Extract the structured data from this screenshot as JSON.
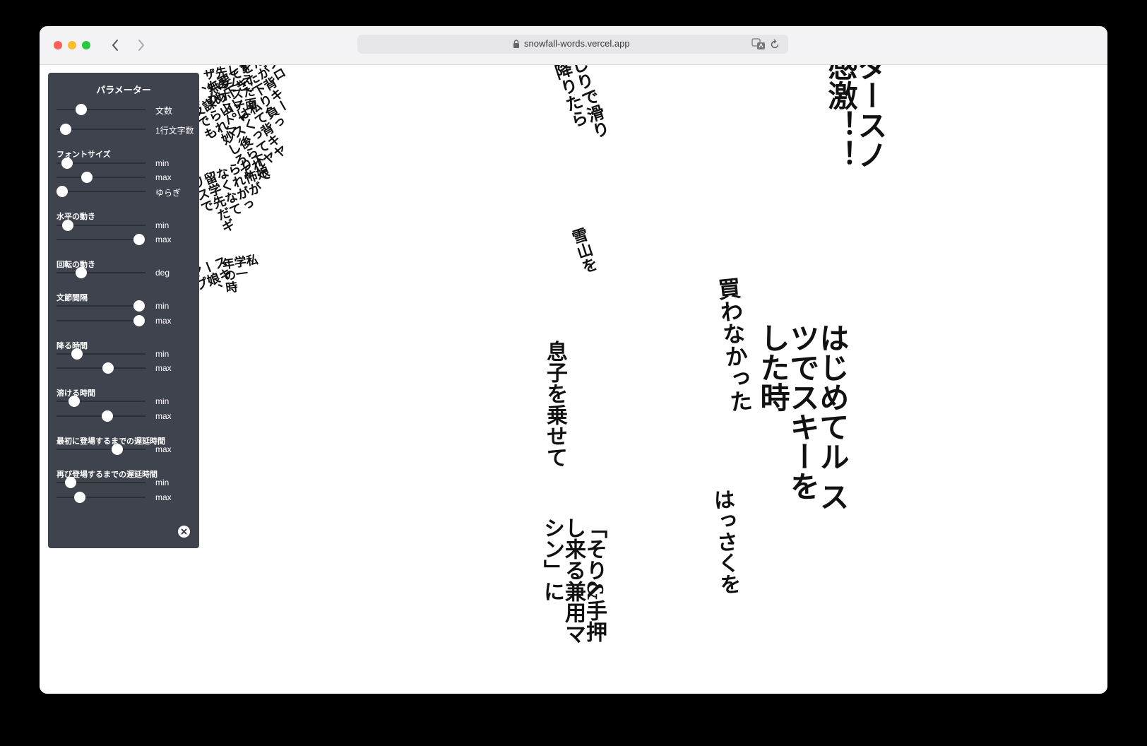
{
  "browser": {
    "url": "snowfall-words.vercel.app"
  },
  "panel": {
    "title": "パラメーター",
    "sections": [
      {
        "label": "",
        "sliders": [
          {
            "label": "文数",
            "value": 0.28
          },
          {
            "label": "1行文字数",
            "value": 0.1
          }
        ]
      },
      {
        "label": "フォントサイズ",
        "sliders": [
          {
            "label": "min",
            "value": 0.12
          },
          {
            "label": "max",
            "value": 0.34
          },
          {
            "label": "ゆらぎ",
            "value": 0.06
          }
        ]
      },
      {
        "label": "水平の動き",
        "sliders": [
          {
            "label": "min",
            "value": 0.13
          },
          {
            "label": "max",
            "value": 0.93
          }
        ]
      },
      {
        "label": "回転の動き",
        "sliders": [
          {
            "label": "deg",
            "value": 0.28
          }
        ]
      },
      {
        "label": "文節間隔",
        "sliders": [
          {
            "label": "min",
            "value": 0.93
          },
          {
            "label": "max",
            "value": 0.93
          }
        ]
      },
      {
        "label": "降る時間",
        "sliders": [
          {
            "label": "min",
            "value": 0.23
          },
          {
            "label": "max",
            "value": 0.58
          }
        ]
      },
      {
        "label": "溶ける時間",
        "sliders": [
          {
            "label": "min",
            "value": 0.2
          },
          {
            "label": "max",
            "value": 0.57
          }
        ]
      },
      {
        "label": "最初に登場するまでの遅延時間",
        "sliders": [
          {
            "label": "max",
            "value": 0.68
          }
        ]
      },
      {
        "label": "再び登場するまでの遅延時間",
        "sliders": [
          {
            "label": "min",
            "value": 0.16
          },
          {
            "label": "max",
            "value": 0.26
          }
        ]
      }
    ]
  },
  "words": [
    "ダースノ\n感激！！",
    "しりで滑り\n降りたら",
    "雪山を",
    "買わなかった",
    "はじめてル ス\nツでスキーを\nした時",
    "息子を乗せて",
    "はっさくを",
    "「そり&手押\nし来る兼用マ\nシン」に",
    "1プロ\nたが背キー\nをた下り負っ\nてき、私て背キヤ\n要下レはくってヤ\n無め山。ス後られて\n、謀られ妙しろて\n報反でも",
    "下娘\nり怖が\nられがっ\nなくなて\n留学先だギ\nリスで",
    "私\n学一\n年の時",
    "すえた面\nしムスティ\n先のホストマ\nザーが",
    "スキ\nー娘、\nヤプ\nロ",
    "スキー場\n15年前くら\nい"
  ]
}
